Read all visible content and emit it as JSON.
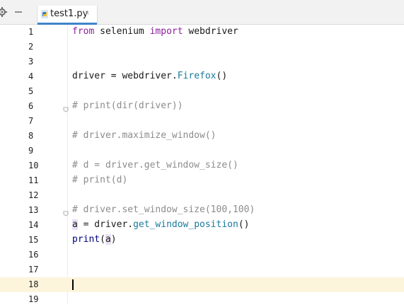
{
  "tab": {
    "filename": "test1.py",
    "close_glyph": "×"
  },
  "toolbar": {
    "settings_icon": "gear-icon",
    "hide_icon": "minus-icon"
  },
  "lines": [
    {
      "n": "1",
      "tokens": [
        [
          "from",
          "kw2"
        ],
        [
          " selenium ",
          ""
        ],
        [
          "import",
          "kw2"
        ],
        [
          " webdriver",
          ""
        ]
      ]
    },
    {
      "n": "2",
      "tokens": []
    },
    {
      "n": "3",
      "tokens": []
    },
    {
      "n": "4",
      "tokens": [
        [
          "driver = webdriver.",
          ""
        ],
        [
          "Firefox",
          "call"
        ],
        [
          "()",
          ""
        ]
      ]
    },
    {
      "n": "5",
      "tokens": []
    },
    {
      "n": "6",
      "tokens": [
        [
          "# print(dir(driver))",
          "cm"
        ]
      ],
      "fold": true
    },
    {
      "n": "7",
      "tokens": []
    },
    {
      "n": "8",
      "tokens": [
        [
          "# driver.maximize_window()",
          "cm"
        ]
      ]
    },
    {
      "n": "9",
      "tokens": []
    },
    {
      "n": "10",
      "tokens": [
        [
          "# d = driver.get_window_size()",
          "cm"
        ]
      ]
    },
    {
      "n": "11",
      "tokens": [
        [
          "# print(d)",
          "cm"
        ]
      ]
    },
    {
      "n": "12",
      "tokens": []
    },
    {
      "n": "13",
      "tokens": [
        [
          "# driver.set_window_size(100,100)",
          "cm"
        ]
      ],
      "fold": true
    },
    {
      "n": "14",
      "tokens": [
        [
          "a",
          "hl"
        ],
        [
          " = driver.",
          ""
        ],
        [
          "get_window_position",
          "call"
        ],
        [
          "()",
          ""
        ]
      ]
    },
    {
      "n": "15",
      "tokens": [
        [
          "print",
          "builtin"
        ],
        [
          "(",
          ""
        ],
        [
          "a",
          "hl"
        ],
        [
          ")",
          ""
        ]
      ]
    },
    {
      "n": "16",
      "tokens": []
    },
    {
      "n": "17",
      "tokens": []
    },
    {
      "n": "18",
      "tokens": [],
      "current": true
    },
    {
      "n": "19",
      "tokens": []
    }
  ]
}
